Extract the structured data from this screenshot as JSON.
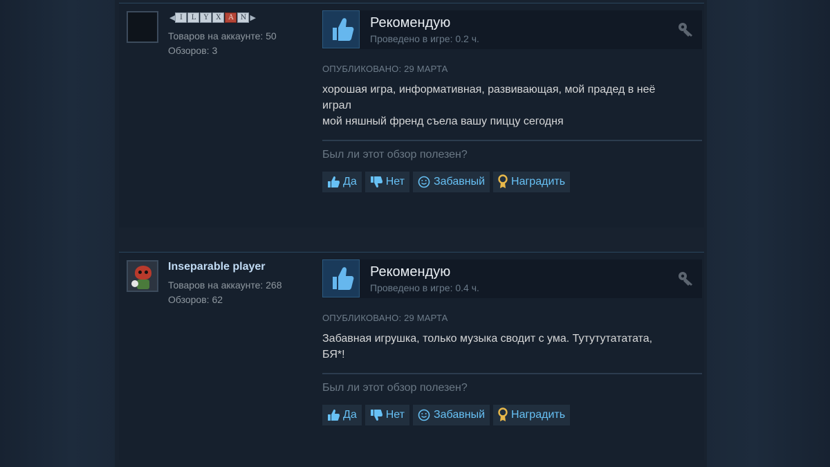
{
  "reviews": [
    {
      "user": {
        "name_letters": [
          "I",
          "L",
          "Y",
          "X",
          "A",
          "N"
        ],
        "red_letter_index": 4,
        "products_label": "Товаров на аккаунте: 50",
        "reviews_label": "Обзоров: 3"
      },
      "recommend_title": "Рекомендую",
      "hours": "Проведено в игре: 0.2 ч.",
      "posted": "ОПУБЛИКОВАНО: 29 МАРТА",
      "text_lines": [
        "хорошая игра, информативная, развивающая, мой прадед в неё",
        "играл",
        "мой няшный френд съела вашу пиццу сегодня"
      ],
      "helpful_question": "Был ли этот обзор полезен?",
      "buttons": {
        "yes": "Да",
        "no": "Нет",
        "funny": "Забавный",
        "award": "Наградить"
      }
    },
    {
      "user": {
        "name": "Inseparable player",
        "products_label": "Товаров на аккаунте: 268",
        "reviews_label": "Обзоров: 62"
      },
      "recommend_title": "Рекомендую",
      "hours": "Проведено в игре: 0.4 ч.",
      "posted": "ОПУБЛИКОВАНО: 29 МАРТА",
      "text_lines": [
        "Забавная игрушка, только музыка сводит с ума. Тутутутататата,",
        "БЯ*!"
      ],
      "helpful_question": "Был ли этот обзор полезен?",
      "buttons": {
        "yes": "Да",
        "no": "Нет",
        "funny": "Забавный",
        "award": "Наградить"
      }
    }
  ],
  "icons": {
    "thumb": "thumbs-up-icon",
    "key": "key-icon",
    "yes": "thumbs-up-icon",
    "no": "thumbs-down-icon",
    "funny": "smiley-icon",
    "award": "award-icon"
  },
  "colors": {
    "background": "#1b2838",
    "card": "#16202d",
    "link": "#67c1f5",
    "award_gold": "#e8b84a"
  }
}
